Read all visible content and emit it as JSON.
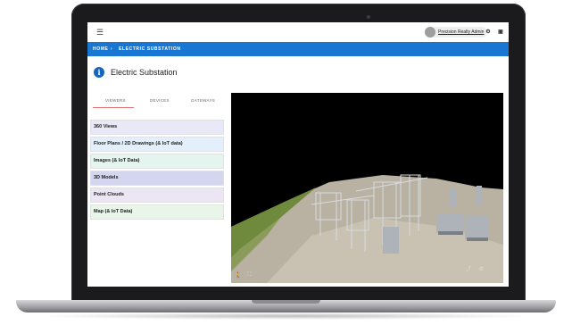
{
  "topbar": {
    "menu_icon": "hamburger-icon",
    "user_name": "Precision Realty Admin",
    "icons": [
      "settings-icon",
      "feedback-icon"
    ]
  },
  "breadcrumb": {
    "home": "HOME",
    "separator": "›",
    "current": "ELECTRIC SUBSTATION"
  },
  "page": {
    "title": "Electric Substation",
    "info_icon": "info-icon"
  },
  "tabs": [
    {
      "label": "VIEWERS",
      "active": true
    },
    {
      "label": "DEVICES",
      "active": false
    },
    {
      "label": "GATEWAYS",
      "active": false
    }
  ],
  "viewer_list": [
    {
      "label": "360 Views",
      "color": "#e8e8f6"
    },
    {
      "label": "Floor Plans / 2D Drawings (& IoT data)",
      "color": "#e3f0fb"
    },
    {
      "label": "Images (& IoT Data)",
      "color": "#e4f4ee"
    },
    {
      "label": "3D Models",
      "color": "#d4d6f0"
    },
    {
      "label": "Point Clouds",
      "color": "#ece6f4"
    },
    {
      "label": "Map (& IoT Data)",
      "color": "#e9f5e9"
    }
  ],
  "viewer": {
    "content": "3d-point-cloud-substation",
    "controls": [
      "walk-icon",
      "fullscreen-icon",
      "share-icon",
      "settings-icon"
    ]
  },
  "colors": {
    "accent": "#1976d2",
    "active_tab": "#e57373"
  }
}
